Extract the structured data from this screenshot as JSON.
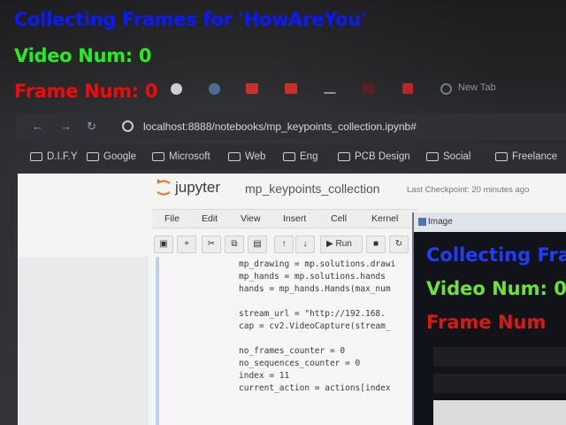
{
  "overlay": {
    "title": "Collecting Frames for 'HowAreYou'",
    "video_num": "Video Num: 0",
    "frame_num": "Frame Num: 0",
    "colors": {
      "title": "#0a1aff",
      "video": "#22f01c",
      "frame": "#f20a0a"
    }
  },
  "browser": {
    "new_tab_label": "New Tab",
    "url": "localhost:8888/notebooks/mp_keypoints_collection.ipynb#",
    "bookmarks": [
      "D.I.F.Y",
      "Google",
      "Microsoft",
      "Web",
      "Eng",
      "PCB Design",
      "Social",
      "Freelance"
    ]
  },
  "jupyter": {
    "logo": "jupyter",
    "notebook_name": "mp_keypoints_collection",
    "checkpoint": "Last Checkpoint: 20 minutes ago",
    "menus": [
      "File",
      "Edit",
      "View",
      "Insert",
      "Cell",
      "Kernel"
    ],
    "run_label": "Run",
    "code_lines": [
      "mp_drawing = mp.solutions.drawi",
      "mp_hands = mp.solutions.hands",
      "hands = mp_hands.Hands(max_num",
      "",
      "stream_url = \"http://192.168.",
      "cap = cv2.VideoCapture(stream_",
      "",
      "no_frames_counter = 0",
      "no_sequences_counter = 0",
      "index = 11",
      "current_action = actions[index"
    ]
  },
  "image_window": {
    "title": "Image",
    "line1": "Collecting Fra",
    "line2": "Video Num: 0",
    "line3": "Frame Num"
  }
}
